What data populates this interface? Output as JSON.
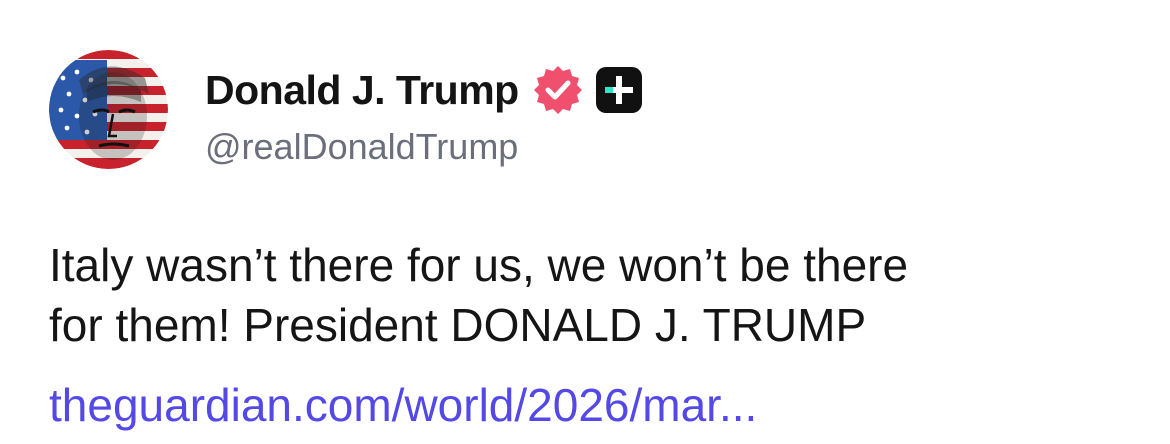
{
  "post": {
    "author": {
      "display_name": "Donald J. Trump",
      "handle": "@realDonaldTrump",
      "avatar_icon": "flag-portrait-avatar",
      "verified_icon": "verified-check-badge-icon",
      "plus_icon": "plus-badge-icon"
    },
    "text_lines": [
      "Italy wasn’t there for us, we won’t be there",
      "for them! President DONALD J. TRUMP"
    ],
    "link_text": "theguardian.com/world/2026/mar..."
  },
  "colors": {
    "text": "#151515",
    "handle": "#6b6f7b",
    "link": "#5448e6",
    "verified_badge": "#f0506e",
    "plus_badge_bg": "#111111",
    "plus_badge_accent": "#2ee6c8"
  }
}
